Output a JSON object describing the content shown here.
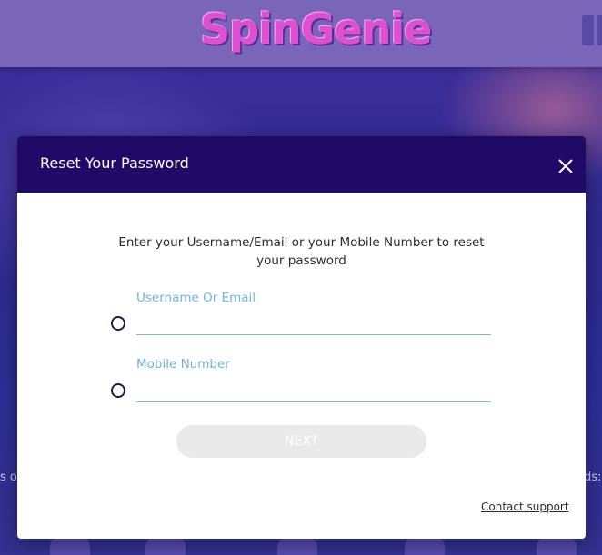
{
  "background": {
    "logo_text": "SpinGenie",
    "left_fragment": "s o",
    "right_fragment": "ds:"
  },
  "modal": {
    "title": "Reset Your Password",
    "instructions": "Enter your Username/Email or your Mobile Number to reset your password",
    "fields": [
      {
        "label": "Username Or Email",
        "value": ""
      },
      {
        "label": "Mobile Number",
        "value": ""
      }
    ],
    "next_label": "NEXT",
    "contact_label": "Contact support"
  },
  "colors": {
    "header_bg": "#1f0a68",
    "field_label": "#6fb4d8",
    "next_bg": "#e9e9e9"
  }
}
